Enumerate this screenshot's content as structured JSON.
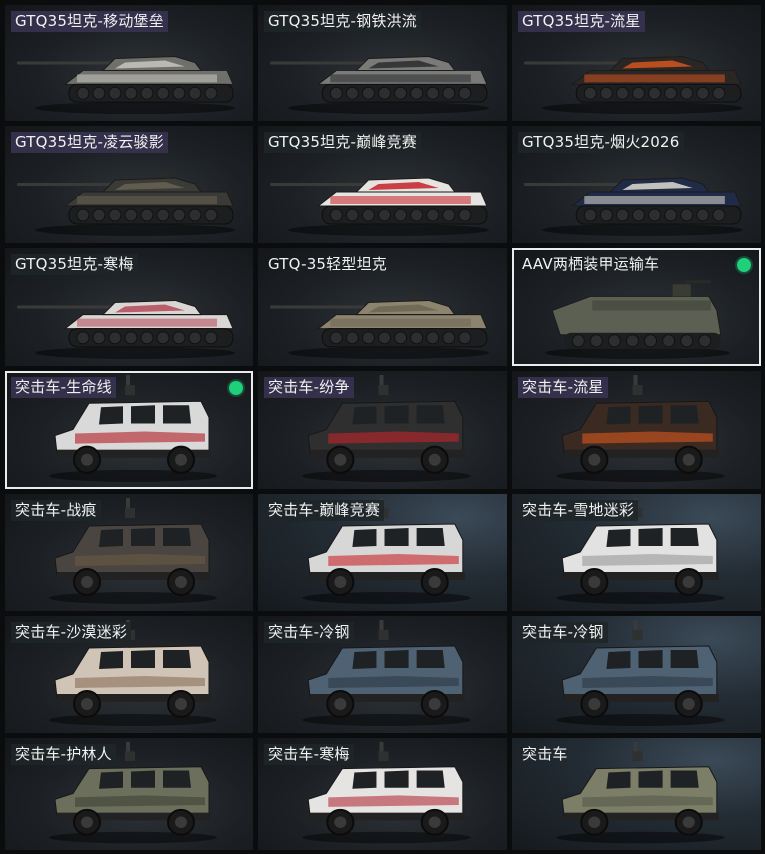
{
  "tiles": [
    {
      "label": "GTQ35坦克-移动堡垒",
      "kind": "tank",
      "body": "#6f6f6c",
      "accent": "#c9c7c0",
      "label_style": "purple"
    },
    {
      "label": "GTQ35坦克-钢铁洪流",
      "kind": "tank",
      "body": "#7a7b78",
      "accent": "#2a2b2d",
      "label_style": "dark"
    },
    {
      "label": "GTQ35坦克-流星",
      "kind": "tank",
      "body": "#2b2624",
      "accent": "#d2561f",
      "label_style": "purple"
    },
    {
      "label": "GTQ35坦克-凌云骏影",
      "kind": "tank",
      "body": "#3a3a37",
      "accent": "#6a6354",
      "label_style": "purple"
    },
    {
      "label": "GTQ35坦克-巅峰竞赛",
      "kind": "tank",
      "body": "#e6e4e1",
      "accent": "#c4222a",
      "label_style": "dark"
    },
    {
      "label": "GTQ35坦克-烟火2026",
      "kind": "tank",
      "body": "#1f2b47",
      "accent": "#e0dcd0",
      "label_style": "dark"
    },
    {
      "label": "GTQ35坦克-寒梅",
      "kind": "tank",
      "body": "#d9d6d4",
      "accent": "#b24a58",
      "label_style": "dark"
    },
    {
      "label": "GTQ-35轻型坦克",
      "kind": "tank",
      "body": "#8d8470",
      "accent": "#6d6452",
      "label_style": "plain"
    },
    {
      "label": "AAV两栖装甲运输车",
      "kind": "aav",
      "body": "#5c6052",
      "accent": "#44473c",
      "label_style": "plain",
      "selected": true,
      "status_dot": "green"
    },
    {
      "label": "突击车-生命线",
      "kind": "truck",
      "body": "#d9d9d9",
      "accent": "#b31c24",
      "label_style": "purple",
      "selected": true,
      "status_dot": "green"
    },
    {
      "label": "突击车-纷争",
      "kind": "truck",
      "body": "#2f2f2f",
      "accent": "#c2252b",
      "label_style": "purple"
    },
    {
      "label": "突击车-流星",
      "kind": "truck",
      "body": "#3a2a22",
      "accent": "#d8581f",
      "label_style": "purple"
    },
    {
      "label": "突击车-战痕",
      "kind": "truck",
      "body": "#4a4540",
      "accent": "#6b5a45",
      "label_style": "dark"
    },
    {
      "label": "突击车-巅峰竞赛",
      "kind": "truck",
      "body": "#d7d7d7",
      "accent": "#c8242b",
      "label_style": "dark",
      "bluebg": true
    },
    {
      "label": "突击车-雪地迷彩",
      "kind": "truck",
      "body": "#e2e2e2",
      "accent": "#9a9a9a",
      "label_style": "dark",
      "bluebg": true
    },
    {
      "label": "突击车-沙漠迷彩",
      "kind": "truck",
      "body": "#cfc4b6",
      "accent": "#8b6f58",
      "label_style": "dark"
    },
    {
      "label": "突击车-冷钢",
      "kind": "truck",
      "body": "#4f6274",
      "accent": "#2d3946",
      "label_style": "dark"
    },
    {
      "label": "突击车-冷钢",
      "kind": "truck",
      "body": "#4f6274",
      "accent": "#2d3946",
      "label_style": "dark",
      "bluebg": true
    },
    {
      "label": "突击车-护林人",
      "kind": "truck",
      "body": "#6c6f5c",
      "accent": "#3c4234",
      "label_style": "dark"
    },
    {
      "label": "突击车-寒梅",
      "kind": "truck",
      "body": "#e6e4e3",
      "accent": "#b2303b",
      "label_style": "dark"
    },
    {
      "label": "突击车",
      "kind": "truck",
      "body": "#7c7e68",
      "accent": "#575a47",
      "label_style": "plain",
      "bluebg": true
    }
  ]
}
